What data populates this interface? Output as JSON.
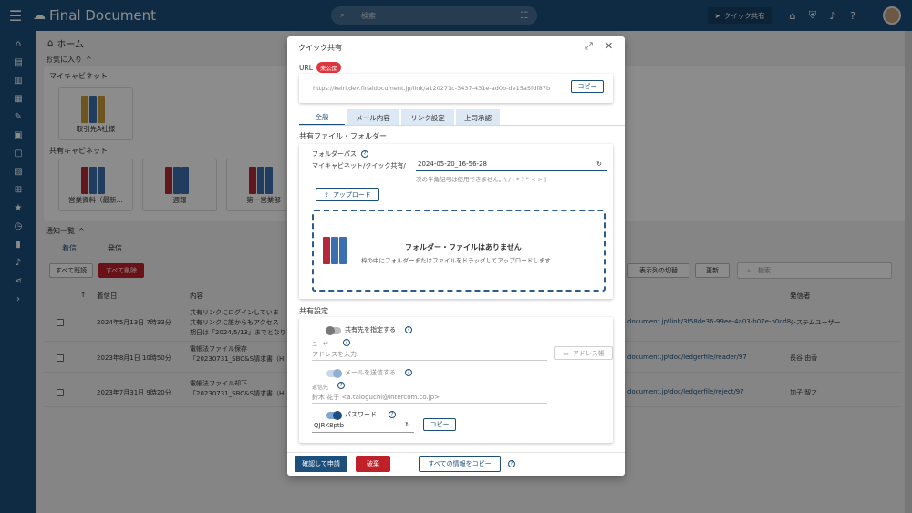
{
  "app": {
    "title": "Final Document"
  },
  "topbar": {
    "search_placeholder": "検索",
    "quick_share_label": "クイック共有"
  },
  "page": {
    "breadcrumb": "ホーム",
    "favorites_title": "お気に入り",
    "my_cabinet_title": "マイキャビネット",
    "my_cabinet_items": [
      "取引先A社様"
    ],
    "shared_cabinet_title": "共有キャビネット",
    "shared_cabinet_items": [
      "営業資料（最新…",
      "週報",
      "第一営業部"
    ],
    "notify_title": "通知一覧",
    "notify_tabs": [
      "着信",
      "発信"
    ],
    "mark_all_read": "すべて既読",
    "delete_all": "すべて削除",
    "column_switch": "表示列の切替",
    "refresh": "更新",
    "table_search_placeholder": "検索",
    "columns": {
      "received": "着信日",
      "content": "内容",
      "sender": "発信者"
    },
    "rows": [
      {
        "date": "2024年5月13日 7時33分",
        "content": [
          "共有リンクにログインしていま",
          "共有リンクに誰からもアクセス",
          "期日は「2024/5/13」までとなり"
        ],
        "link": "document.jp/link/3f58de36-99ee-4a03-b07e-b0cd8",
        "sender": "システムユーザー"
      },
      {
        "date": "2023年8月1日 10時50分",
        "content": [
          "電帳法ファイル保存",
          "「20230731_SBC&S請求書（H"
        ],
        "link": "document.jp/doc/ledgerfile/reader/97",
        "sender": "長谷 由香"
      },
      {
        "date": "2023年7月31日 9時20分",
        "content": [
          "電帳法ファイル却下",
          "「20230731_SBC&S請求書（H"
        ],
        "link": "document.jp/doc/ledgerfile/reject/97",
        "sender": "加子 智之"
      }
    ]
  },
  "dialog": {
    "title": "クイック共有",
    "url_label": "URL",
    "url_badge": "未公開",
    "url_value": "https://keiri.dev.finaldocument.jp/link/a120271c-3437-431e-ad0b-de15a5fdf87b",
    "copy_label": "コピー",
    "tabs": [
      "全般",
      "メール内容",
      "リンク設定",
      "上司承認"
    ],
    "share_section_title": "共有ファイル・フォルダー",
    "folder_path_label": "フォルダーパス",
    "folder_path_prefix": "マイキャビネット/クイック共有/",
    "folder_name_value": "2024-05-20_16-56-28",
    "folder_hint": "次の半角記号は使用できません。\\ / : * ? \" < > |",
    "upload_label": "アップロード",
    "empty_title": "フォルダー・ファイルはありません",
    "empty_sub": "枠の中にフォルダーまたはファイルをドラッグしてアップロードします",
    "share_settings_title": "共有設定",
    "specify_recipient_label": "共有先を指定する",
    "user_label": "ユーザー",
    "user_placeholder": "アドレスを入力",
    "address_book_label": "アドレス帳",
    "send_mail_label": "メールを送信する",
    "cc_label": "返信先",
    "cc_value": "鈴木 花子 <a.taloguchi@intercom.co.jp>",
    "password_label": "パスワード",
    "password_value": "QJRK8ptb",
    "confirm_request": "確認して申請",
    "discard": "破棄",
    "copy_all_info": "すべての情報をコピー"
  },
  "colors": {
    "brand": "#1d4f7c",
    "danger": "#c0202a",
    "badge": "#e0343e"
  }
}
